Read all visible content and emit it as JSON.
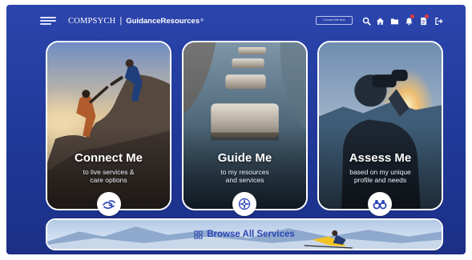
{
  "header": {
    "brand_name": "COMPSYCH",
    "separator": "|",
    "product_name": "GuidanceResources",
    "registered_mark": "®",
    "connect_button_label": "Connect Me Now",
    "icons": [
      "menu-icon",
      "search-icon",
      "home-icon",
      "folder-icon",
      "bell-icon",
      "document-icon",
      "logout-icon"
    ]
  },
  "cards": [
    {
      "title": "Connect Me",
      "subtitle_line1": "to live services &",
      "subtitle_line2": "care options",
      "icon": "helping-hands-icon"
    },
    {
      "title": "Guide Me",
      "subtitle_line1": "to my resources",
      "subtitle_line2": "and services",
      "icon": "compass-icon"
    },
    {
      "title": "Assess Me",
      "subtitle_line1": "based on my unique",
      "subtitle_line2": "profile and needs",
      "icon": "binoculars-icon"
    }
  ],
  "browse": {
    "label": "Browse All Services",
    "icon": "grid-icon"
  },
  "colors": {
    "background": "#213a9b",
    "accent_blue": "#2c46b4",
    "notification_red": "#e23b3b",
    "white": "#ffffff"
  }
}
